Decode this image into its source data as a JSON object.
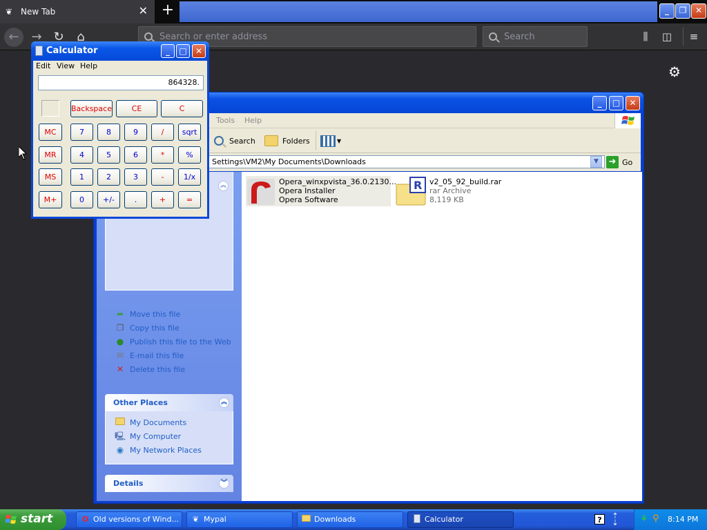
{
  "browser": {
    "tab_title": "New Tab",
    "url_placeholder": "Search or enter address",
    "search_placeholder": "Search"
  },
  "explorer": {
    "menu": [
      "Tools",
      "Help"
    ],
    "toolbar": {
      "search_label": "Search",
      "folders_label": "Folders"
    },
    "address": "Settings\\VM2\\My Documents\\Downloads",
    "go_label": "Go",
    "file_tasks": [
      {
        "label": "Move this file",
        "icon": "move-icon"
      },
      {
        "label": "Copy this file",
        "icon": "copy-icon"
      },
      {
        "label": "Publish this file to the Web",
        "icon": "publish-web-icon"
      },
      {
        "label": "E-mail this file",
        "icon": "email-icon"
      },
      {
        "label": "Delete this file",
        "icon": "delete-icon"
      }
    ],
    "other_places": {
      "title": "Other Places",
      "items": [
        {
          "label": "My Documents",
          "icon": "folder-icon"
        },
        {
          "label": "My Computer",
          "icon": "computer-icon"
        },
        {
          "label": "My Network Places",
          "icon": "network-icon"
        }
      ]
    },
    "details": {
      "title": "Details"
    },
    "files": [
      {
        "name": "Opera_winxpvista_36.0.2130...",
        "line2": "Opera Installer",
        "line3": "Opera Software",
        "icon": "opera-icon"
      },
      {
        "name": "v2_05_92_build.rar",
        "line2": "rar Archive",
        "line3": "8,119 KB",
        "icon": "rar-archive-icon"
      }
    ]
  },
  "calculator": {
    "title": "Calculator",
    "menu": [
      "Edit",
      "View",
      "Help"
    ],
    "display": "864328.",
    "top_buttons": [
      "Backspace",
      "CE",
      "C"
    ],
    "rows": [
      [
        "MC",
        "7",
        "8",
        "9",
        "/",
        "sqrt"
      ],
      [
        "MR",
        "4",
        "5",
        "6",
        "*",
        "%"
      ],
      [
        "MS",
        "1",
        "2",
        "3",
        "-",
        "1/x"
      ],
      [
        "M+",
        "0",
        "+/-",
        ".",
        "+",
        "="
      ]
    ]
  },
  "taskbar": {
    "start_label": "start",
    "buttons": [
      {
        "label": "Old versions of Wind...",
        "icon": "opera-icon"
      },
      {
        "label": "Mypal",
        "icon": "mypal-icon"
      },
      {
        "label": "Downloads",
        "icon": "folder-icon"
      },
      {
        "label": "Calculator",
        "icon": "calculator-icon"
      }
    ],
    "clock": "8:14 PM"
  }
}
